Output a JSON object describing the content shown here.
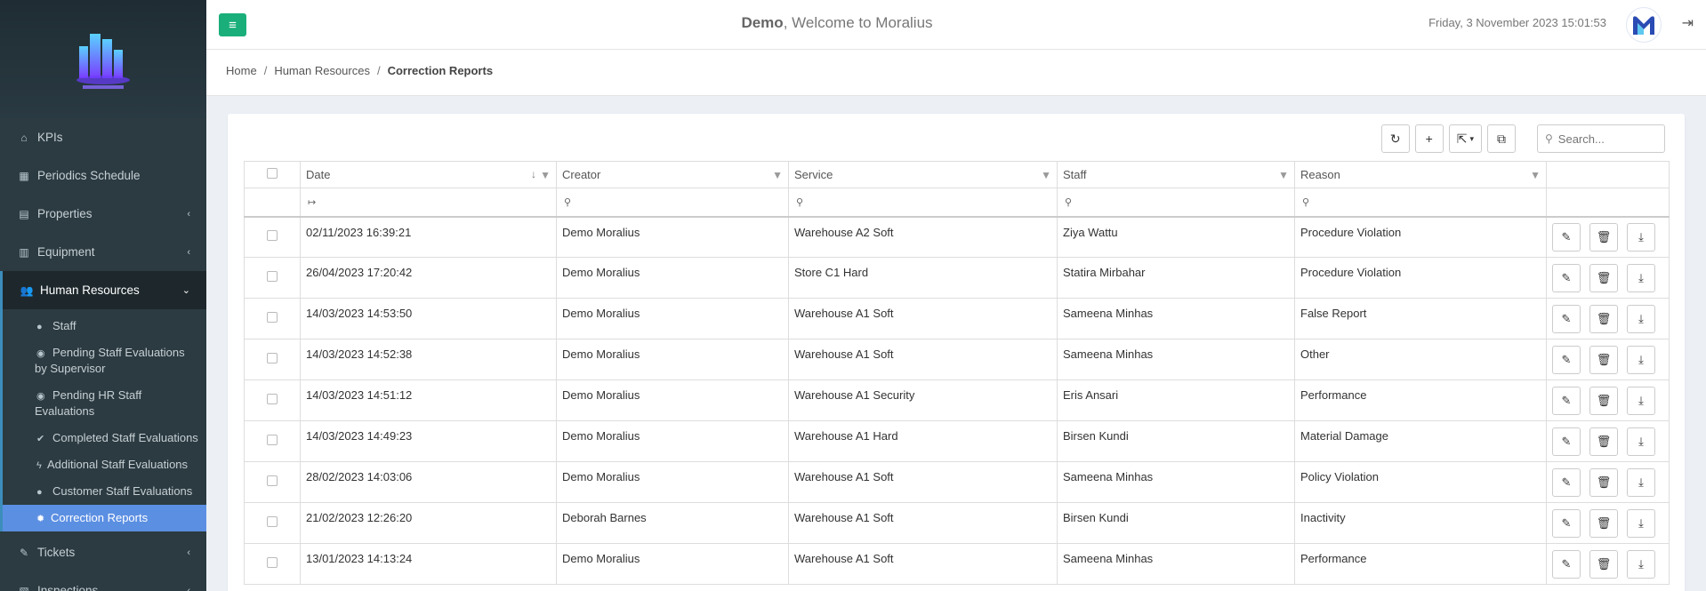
{
  "header": {
    "user": "Demo",
    "welcome_rest": ", Welcome to Moralius",
    "datetime": "Friday, 3 November 2023 15:01:53"
  },
  "sidebar": {
    "items": [
      {
        "label": "KPIs",
        "icon": "dashboard-icon"
      },
      {
        "label": "Periodics Schedule",
        "icon": "calendar-icon"
      },
      {
        "label": "Properties",
        "icon": "building-icon"
      },
      {
        "label": "Equipment",
        "icon": "equipment-icon"
      },
      {
        "label": "Human Resources",
        "icon": "users-icon"
      }
    ],
    "sub_items": [
      {
        "label": "Staff",
        "icon": "users-icon"
      },
      {
        "label": "Pending Staff Evaluations by Supervisor",
        "icon": "user-circle-icon"
      },
      {
        "label": "Pending HR Staff Evaluations",
        "icon": "user-circle-icon"
      },
      {
        "label": "Completed Staff Evaluations",
        "icon": "check-icon"
      },
      {
        "label": "Additional Staff Evaluations",
        "icon": "bolt-icon"
      },
      {
        "label": "Customer Staff Evaluations",
        "icon": "users-icon"
      },
      {
        "label": "Correction Reports",
        "icon": "bug-icon"
      }
    ],
    "bottom_items": [
      {
        "label": "Tickets",
        "icon": "ticket-icon"
      },
      {
        "label": "Inspections",
        "icon": "map-icon"
      }
    ]
  },
  "breadcrumb": {
    "home": "Home",
    "section": "Human Resources",
    "current": "Correction Reports"
  },
  "search": {
    "placeholder": "Search..."
  },
  "table": {
    "columns": [
      "Date",
      "Creator",
      "Service",
      "Staff",
      "Reason"
    ],
    "rows": [
      {
        "date": "02/11/2023 16:39:21",
        "creator": "Demo Moralius",
        "service": "Warehouse A2 Soft",
        "staff": "Ziya Wattu",
        "reason": "Procedure Violation"
      },
      {
        "date": "26/04/2023 17:20:42",
        "creator": "Demo Moralius",
        "service": "Store C1 Hard",
        "staff": "Statira Mirbahar",
        "reason": "Procedure Violation"
      },
      {
        "date": "14/03/2023 14:53:50",
        "creator": "Demo Moralius",
        "service": "Warehouse A1 Soft",
        "staff": "Sameena Minhas",
        "reason": "False Report"
      },
      {
        "date": "14/03/2023 14:52:38",
        "creator": "Demo Moralius",
        "service": "Warehouse A1 Soft",
        "staff": "Sameena Minhas",
        "reason": "Other"
      },
      {
        "date": "14/03/2023 14:51:12",
        "creator": "Demo Moralius",
        "service": "Warehouse A1 Security",
        "staff": "Eris Ansari",
        "reason": "Performance"
      },
      {
        "date": "14/03/2023 14:49:23",
        "creator": "Demo Moralius",
        "service": "Warehouse A1 Hard",
        "staff": "Birsen Kundi",
        "reason": "Material Damage"
      },
      {
        "date": "28/02/2023 14:03:06",
        "creator": "Demo Moralius",
        "service": "Warehouse A1 Soft",
        "staff": "Sameena Minhas",
        "reason": "Policy Violation"
      },
      {
        "date": "21/02/2023 12:26:20",
        "creator": "Deborah Barnes",
        "service": "Warehouse A1 Soft",
        "staff": "Birsen Kundi",
        "reason": "Inactivity"
      },
      {
        "date": "13/01/2023 14:13:24",
        "creator": "Demo Moralius",
        "service": "Warehouse A1 Soft",
        "staff": "Sameena Minhas",
        "reason": "Performance"
      }
    ]
  },
  "colors": {
    "accent": "#1aaf7a",
    "link": "#3c8dbc",
    "sidebar_bg": "#2c3b41",
    "sidebar_active": "#5b8fe2"
  }
}
